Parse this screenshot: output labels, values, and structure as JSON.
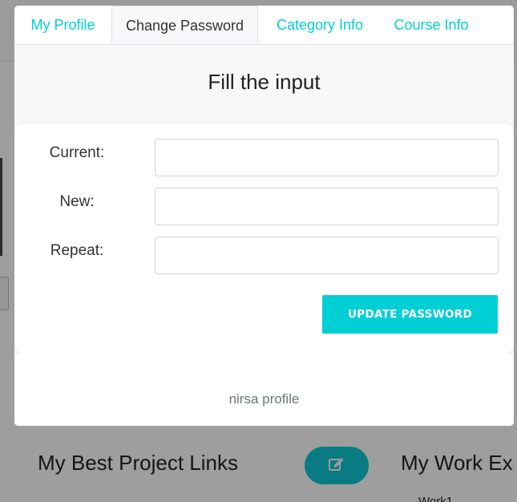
{
  "tabs": [
    {
      "label": "My Profile"
    },
    {
      "label": "Change Password"
    },
    {
      "label": "Category Info"
    },
    {
      "label": "Course Info"
    }
  ],
  "active_tab": "Change Password",
  "form": {
    "title": "Fill the input",
    "fields": [
      {
        "label": "Current:",
        "value": ""
      },
      {
        "label": "New:",
        "value": ""
      },
      {
        "label": "Repeat:",
        "value": ""
      }
    ],
    "submit_label": "UPDATE PASSWORD"
  },
  "footer": {
    "text": "nirsa profile"
  },
  "background": {
    "heading_left": "My Best Project Links",
    "heading_right": "My Work Ex",
    "subtext": "Work1"
  },
  "colors": {
    "accent": "#00cfd5",
    "edit_button": "#10c9d3"
  },
  "icons": {
    "edit": "edit-icon"
  }
}
